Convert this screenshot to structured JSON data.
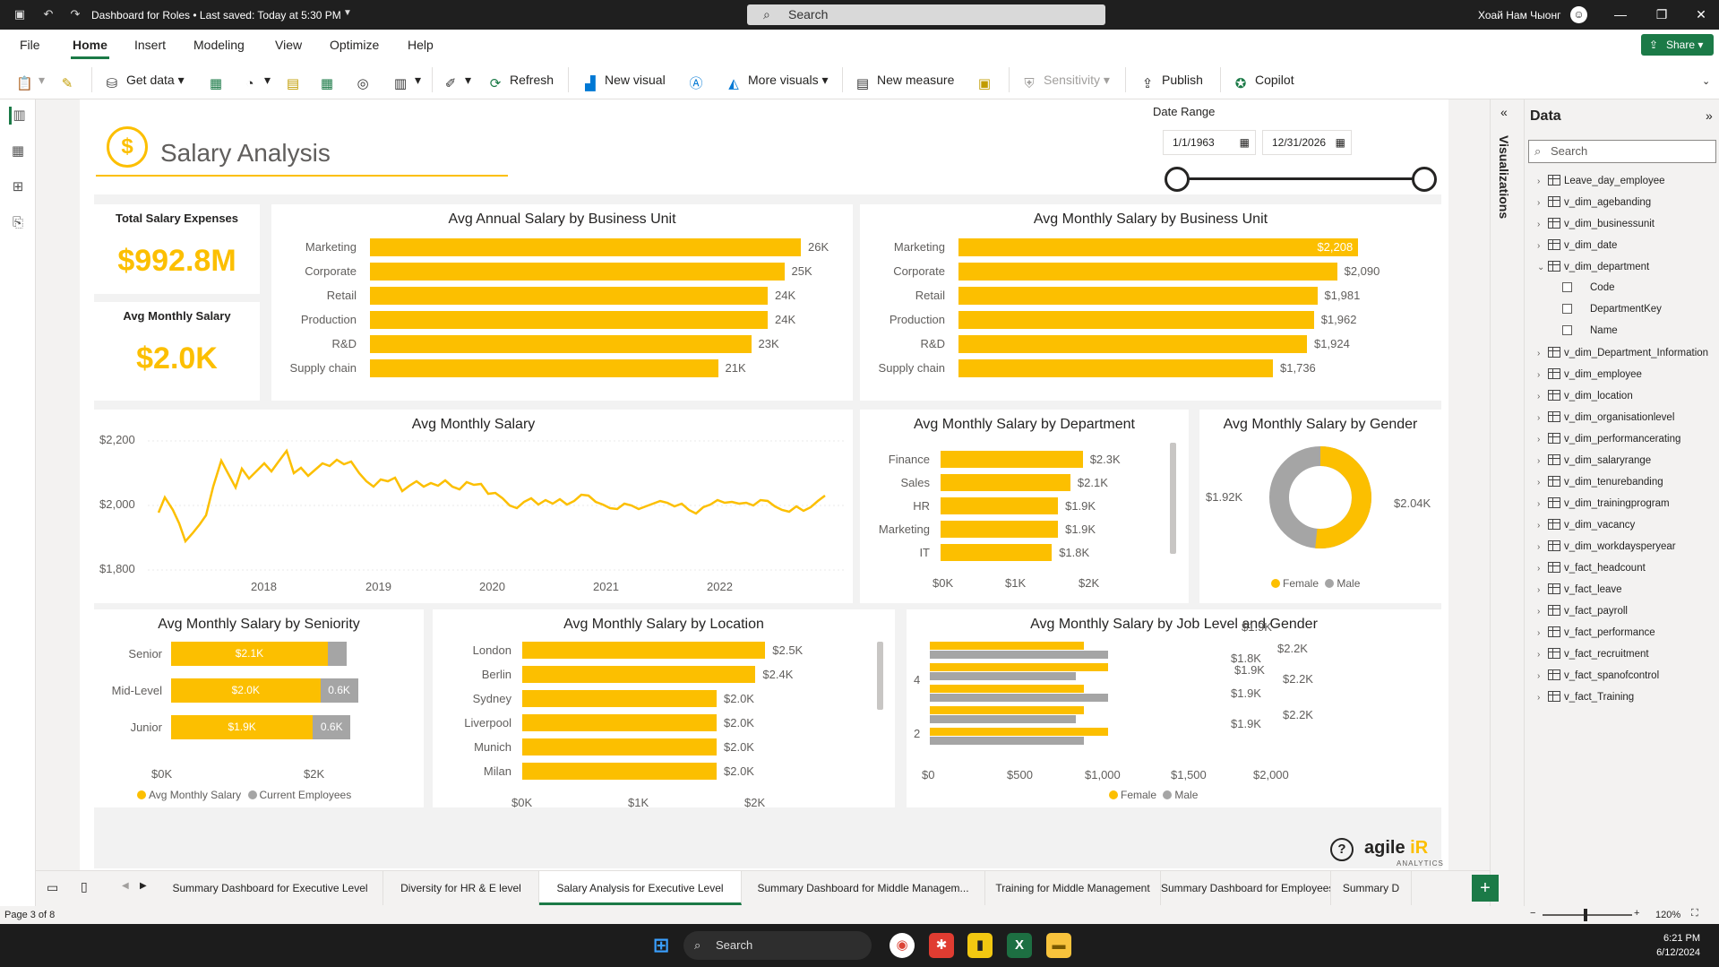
{
  "titlebar": {
    "doc_title": "Dashboard for Roles • Last saved: Today at 5:30 PM",
    "search_placeholder": "Search",
    "user_name": "Хоай Нам Чыонг",
    "avatar_glyph": "☺"
  },
  "menu": [
    "File",
    "Home",
    "Insert",
    "Modeling",
    "View",
    "Optimize",
    "Help"
  ],
  "share_label": "Share",
  "ribbon": {
    "get_data": "Get data",
    "refresh": "Refresh",
    "new_visual": "New visual",
    "more_visuals": "More visuals",
    "new_measure": "New measure",
    "sensitivity": "Sensitivity",
    "publish": "Publish",
    "copilot": "Copilot"
  },
  "report": {
    "title": "Salary Analysis",
    "date_range": {
      "label": "Date Range",
      "start": "1/1/1963",
      "end": "12/31/2026"
    },
    "kpis": [
      {
        "title": "Total Salary Expenses",
        "value": "$992.8M"
      },
      {
        "title": "Avg Monthly Salary",
        "value": "$2.0K"
      }
    ],
    "annual_by_bu": {
      "title": "Avg Annual Salary by Business Unit",
      "rows": [
        {
          "label": "Marketing",
          "value": 26,
          "text": "26K"
        },
        {
          "label": "Corporate",
          "value": 25,
          "text": "25K"
        },
        {
          "label": "Retail",
          "value": 24,
          "text": "24K"
        },
        {
          "label": "Production",
          "value": 24,
          "text": "24K"
        },
        {
          "label": "R&D",
          "value": 23,
          "text": "23K"
        },
        {
          "label": "Supply chain",
          "value": 21,
          "text": "21K"
        }
      ]
    },
    "monthly_by_bu": {
      "title": "Avg Monthly Salary by Business Unit",
      "rows": [
        {
          "label": "Marketing",
          "value": 2208,
          "text": "$2,208"
        },
        {
          "label": "Corporate",
          "value": 2090,
          "text": "$2,090"
        },
        {
          "label": "Retail",
          "value": 1981,
          "text": "$1,981"
        },
        {
          "label": "Production",
          "value": 1962,
          "text": "$1,962"
        },
        {
          "label": "R&D",
          "value": 1924,
          "text": "$1,924"
        },
        {
          "label": "Supply chain",
          "value": 1736,
          "text": "$1,736"
        }
      ]
    },
    "line": {
      "title": "Avg Monthly Salary",
      "y_ticks": [
        "$2,200",
        "$2,000",
        "$1,800"
      ],
      "x_ticks": [
        "2018",
        "2019",
        "2020",
        "2021",
        "2022"
      ]
    },
    "by_department": {
      "title": "Avg Monthly Salary by Department",
      "rows": [
        {
          "label": "Finance",
          "value": 2.3,
          "text": "$2.3K"
        },
        {
          "label": "Sales",
          "value": 2.1,
          "text": "$2.1K"
        },
        {
          "label": "HR",
          "value": 1.9,
          "text": "$1.9K"
        },
        {
          "label": "Marketing",
          "value": 1.9,
          "text": "$1.9K"
        },
        {
          "label": "IT",
          "value": 1.8,
          "text": "$1.8K"
        }
      ],
      "x_ticks": [
        "$0K",
        "$1K",
        "$2K"
      ]
    },
    "by_gender": {
      "title": "Avg Monthly Salary by Gender",
      "female": "$2.04K",
      "male": "$1.92K",
      "legend": [
        "Female",
        "Male"
      ]
    },
    "by_seniority": {
      "title": "Avg Monthly Salary by Seniority",
      "rows": [
        {
          "label": "Senior",
          "salary": 2.1,
          "salary_text": "$2.1K",
          "emp": 0.3,
          "emp_text": ""
        },
        {
          "label": "Mid-Level",
          "salary": 2.0,
          "salary_text": "$2.0K",
          "emp": 0.6,
          "emp_text": "0.6K"
        },
        {
          "label": "Junior",
          "salary": 1.9,
          "salary_text": "$1.9K",
          "emp": 0.6,
          "emp_text": "0.6K"
        }
      ],
      "x_ticks": [
        "$0K",
        "$2K"
      ],
      "legend": [
        "Avg Monthly Salary",
        "Current Employees"
      ]
    },
    "by_location": {
      "title": "Avg Monthly Salary by Location",
      "rows": [
        {
          "label": "London",
          "value": 2.5,
          "text": "$2.5K"
        },
        {
          "label": "Berlin",
          "value": 2.4,
          "text": "$2.4K"
        },
        {
          "label": "Sydney",
          "value": 2.0,
          "text": "$2.0K"
        },
        {
          "label": "Liverpool",
          "value": 2.0,
          "text": "$2.0K"
        },
        {
          "label": "Munich",
          "value": 2.0,
          "text": "$2.0K"
        },
        {
          "label": "Milan",
          "value": 2.0,
          "text": "$2.0K"
        }
      ],
      "x_ticks": [
        "$0K",
        "$1K",
        "$2K"
      ]
    },
    "by_job_level": {
      "title": "Avg Monthly Salary by Job Level and Gender",
      "y_ticks": [
        "4",
        "2"
      ],
      "x_ticks": [
        "$0",
        "$500",
        "$1,000",
        "$1,500",
        "$2,000"
      ],
      "labels": [
        "$1.9K",
        "$2.2K",
        "$1.8K",
        "$1.9K",
        "$2.2K",
        "$1.9K",
        "$2.2K",
        "$1.9K"
      ],
      "legend": [
        "Female",
        "Male"
      ]
    },
    "branding": "agile",
    "branding_sub": "ANALYTICS"
  },
  "data_pane": {
    "title": "Data",
    "search": "Search",
    "viz_label": "Visualizations",
    "fields": [
      {
        "name": "Leave_day_employee",
        "kind": "table"
      },
      {
        "name": "v_dim_agebanding",
        "kind": "table"
      },
      {
        "name": "v_dim_businessunit",
        "kind": "table"
      },
      {
        "name": "v_dim_date",
        "kind": "table"
      },
      {
        "name": "v_dim_department",
        "kind": "table-open"
      },
      {
        "name": "Code",
        "kind": "column"
      },
      {
        "name": "DepartmentKey",
        "kind": "column"
      },
      {
        "name": "Name",
        "kind": "column"
      },
      {
        "name": "v_dim_Department_Information",
        "kind": "table"
      },
      {
        "name": "v_dim_employee",
        "kind": "table"
      },
      {
        "name": "v_dim_location",
        "kind": "table"
      },
      {
        "name": "v_dim_organisationlevel",
        "kind": "table"
      },
      {
        "name": "v_dim_performancerating",
        "kind": "table"
      },
      {
        "name": "v_dim_salaryrange",
        "kind": "table"
      },
      {
        "name": "v_dim_tenurebanding",
        "kind": "table"
      },
      {
        "name": "v_dim_trainingprogram",
        "kind": "table"
      },
      {
        "name": "v_dim_vacancy",
        "kind": "table"
      },
      {
        "name": "v_dim_workdaysperyear",
        "kind": "table"
      },
      {
        "name": "v_fact_headcount",
        "kind": "table"
      },
      {
        "name": "v_fact_leave",
        "kind": "table"
      },
      {
        "name": "v_fact_payroll",
        "kind": "table"
      },
      {
        "name": "v_fact_performance",
        "kind": "table"
      },
      {
        "name": "v_fact_recruitment",
        "kind": "table"
      },
      {
        "name": "v_fact_spanofcontrol",
        "kind": "table"
      },
      {
        "name": "v_fact_Training",
        "kind": "table"
      }
    ]
  },
  "page_tabs": [
    "Summary Dashboard for Executive Level",
    "Diversity for HR & E level",
    "Salary Analysis for Executive Level",
    "Summary Dashboard for Middle Managem...",
    "Training for Middle Management",
    "Summary Dashboard for Employees",
    "Summary D"
  ],
  "active_tab": 2,
  "status": {
    "page": "Page 3 of 8",
    "zoom": "120%"
  },
  "taskbar": {
    "search": "Search",
    "time": "6:21 PM",
    "date": "6/12/2024"
  },
  "colors": {
    "accent": "#fcbf00",
    "grey": "#a5a5a5",
    "brand_green": "#1b7a47"
  }
}
